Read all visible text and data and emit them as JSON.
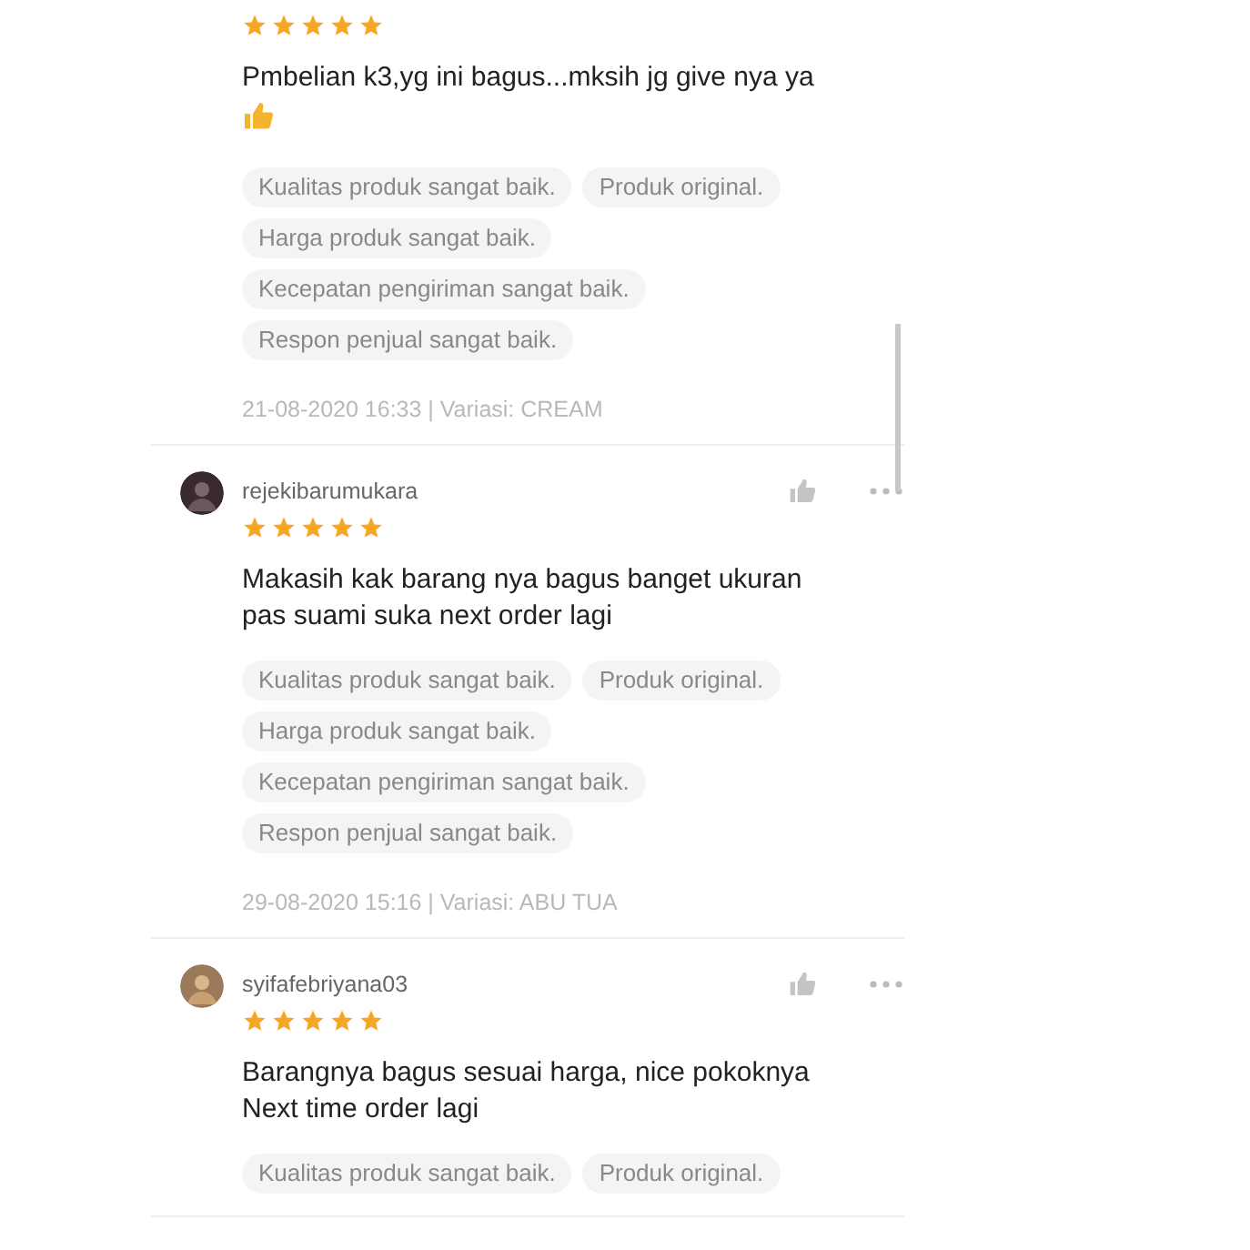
{
  "reviews": [
    {
      "stars": 5,
      "text": "Pmbelian k3,yg ini bagus...mksih jg give nya ya",
      "thumb_emoji": true,
      "tags": [
        "Kualitas produk sangat baik.",
        "Produk original.",
        "Harga produk sangat baik.",
        "Kecepatan pengiriman sangat baik.",
        "Respon penjual sangat baik."
      ],
      "meta": "21-08-2020 16:33 | Variasi: CREAM"
    },
    {
      "username": "rejekibarumukara",
      "stars": 5,
      "text": "Makasih kak barang nya bagus banget ukuran pas suami suka next order lagi",
      "tags": [
        "Kualitas produk sangat baik.",
        "Produk original.",
        "Harga produk sangat baik.",
        "Kecepatan pengiriman sangat baik.",
        "Respon penjual sangat baik."
      ],
      "meta": "29-08-2020 15:16 | Variasi: ABU TUA"
    },
    {
      "username": "syifafebriyana03",
      "stars": 5,
      "text": "Barangnya bagus sesuai harga, nice pokoknya Next time order lagi",
      "tags": [
        "Kualitas produk sangat baik.",
        "Produk original."
      ]
    }
  ]
}
